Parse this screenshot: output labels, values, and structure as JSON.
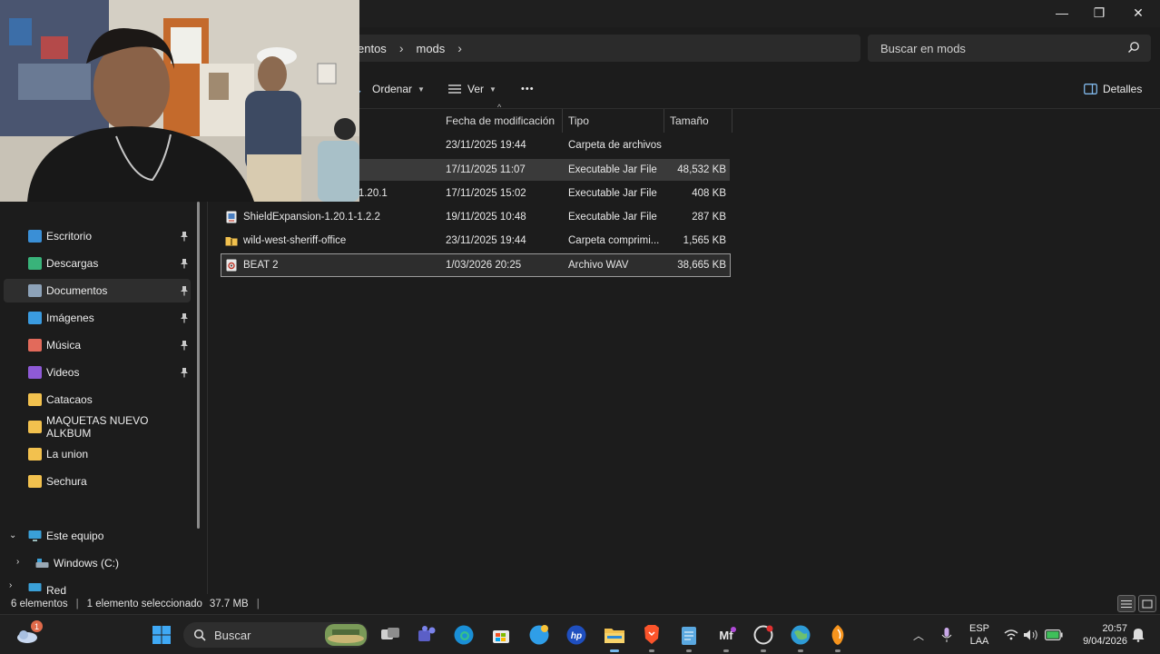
{
  "window": {
    "minimize_glyph": "—",
    "maximize_glyph": "❐",
    "close_glyph": "✕"
  },
  "address": {
    "crumb_partial": "entos",
    "crumb_current": "mods",
    "search_placeholder": "Buscar en mods"
  },
  "toolbar": {
    "sort_label": "Ordenar",
    "view_label": "Ver",
    "more_label": "•••",
    "details_label": "Detalles"
  },
  "columns": {
    "date": "Fecha de modificación",
    "type": "Tipo",
    "size": "Tamaño"
  },
  "files": [
    {
      "name": "",
      "date": "23/11/2025 19:44",
      "type": "Carpeta de archivos",
      "size": ""
    },
    {
      "name": "",
      "date": "17/11/2025 11:07",
      "type": "Executable Jar File",
      "size": "48,532 KB"
    },
    {
      "name": "orge-1.20.1",
      "date": "17/11/2025 15:02",
      "type": "Executable Jar File",
      "size": "408 KB"
    },
    {
      "name": "ShieldExpansion-1.20.1-1.2.2",
      "date": "19/11/2025 10:48",
      "type": "Executable Jar File",
      "size": "287 KB"
    },
    {
      "name": "wild-west-sheriff-office",
      "date": "23/11/2025 19:44",
      "type": "Carpeta comprimi...",
      "size": "1,565 KB"
    },
    {
      "name": "BEAT 2",
      "date": "1/03/2026 20:25",
      "type": "Archivo WAV",
      "size": "38,665 KB"
    }
  ],
  "sidebar": {
    "items": [
      {
        "label": "Escritorio",
        "icon": "desktop-icon",
        "color": "#3a8fd6"
      },
      {
        "label": "Descargas",
        "icon": "download-icon",
        "color": "#39b37a"
      },
      {
        "label": "Documentos",
        "icon": "document-icon",
        "color": "#8da2b8"
      },
      {
        "label": "Imágenes",
        "icon": "image-icon",
        "color": "#3a9be0"
      },
      {
        "label": "Música",
        "icon": "music-icon",
        "color": "#e26a5b"
      },
      {
        "label": "Videos",
        "icon": "video-icon",
        "color": "#8e5ad6"
      },
      {
        "label": "Catacaos",
        "icon": "folder-icon",
        "color": "#f2c14e"
      },
      {
        "label": "MAQUETAS NUEVO ALKBUM",
        "icon": "folder-icon",
        "color": "#f2c14e"
      },
      {
        "label": "La union",
        "icon": "folder-icon",
        "color": "#f2c14e"
      },
      {
        "label": "Sechura",
        "icon": "folder-icon",
        "color": "#f2c14e"
      }
    ],
    "this_pc": "Este equipo",
    "drive": "Windows (C:)",
    "network": "Red"
  },
  "status": {
    "count": "6 elementos",
    "selection": "1 elemento seleccionado",
    "size": "37.7 MB"
  },
  "taskbar": {
    "search_label": "Buscar",
    "weather_badge": "1",
    "tray": {
      "lang_top": "ESP",
      "lang_bottom": "LAA",
      "time": "20:57",
      "date": "9/04/2026"
    }
  },
  "colors": {
    "accent": "#76b9ed",
    "folder": "#f2c14e",
    "background": "#1c1c1c"
  }
}
